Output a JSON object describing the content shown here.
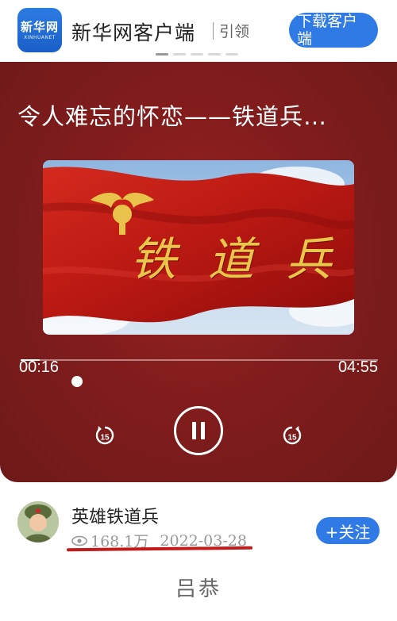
{
  "app_banner": {
    "logo_text": "新华网",
    "logo_subtext": "XINHUANET",
    "app_name": "新华网客户端",
    "slogan": "引领",
    "download_label": "下载客户端",
    "brand_color": "#2f7ae5"
  },
  "player": {
    "title": "令人难忘的怀恋——铁道兵…",
    "cover_text": "铁道兵",
    "elapsed": "00:16",
    "duration": "04:55",
    "progress_fraction": 0.054,
    "rewind_label": "15",
    "forward_label": "15",
    "icons": {
      "rewind": "rewind-15-icon",
      "pause": "pause-icon",
      "forward": "forward-15-icon"
    }
  },
  "author": {
    "name": "英雄铁道兵",
    "views": "168.1万",
    "date": "2022-03-28",
    "follow_label": "+关注"
  },
  "singer": "吕恭"
}
